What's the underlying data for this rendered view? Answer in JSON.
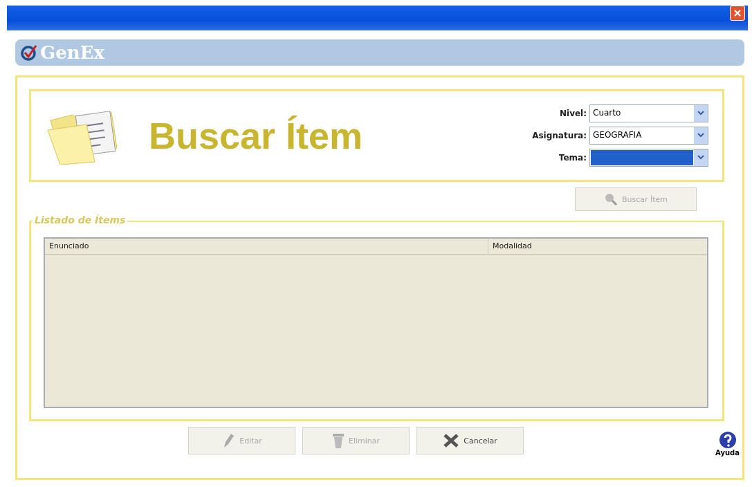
{
  "app": {
    "logo": "GenEx"
  },
  "header": {
    "title": "Buscar Ítem"
  },
  "filters": [
    {
      "label": "Nivel:",
      "value": "Cuarto",
      "focused": false
    },
    {
      "label": "Asignatura:",
      "value": "GEOGRAFIA",
      "focused": false
    },
    {
      "label": "Tema:",
      "focused": true
    }
  ],
  "search_button": {
    "label": "Buscar Ítem",
    "disabled": true
  },
  "list": {
    "legend": "Listado de Ítems",
    "columns": [
      "Enunciado",
      "Modalidad"
    ]
  },
  "buttons": [
    {
      "kind": "edit",
      "label": "Editar",
      "disabled": true
    },
    {
      "kind": "delete",
      "label": "Eliminar",
      "disabled": true
    },
    {
      "kind": "cancel",
      "label": "Cancelar",
      "disabled": false
    }
  ],
  "help": {
    "label": "Ayuda"
  }
}
